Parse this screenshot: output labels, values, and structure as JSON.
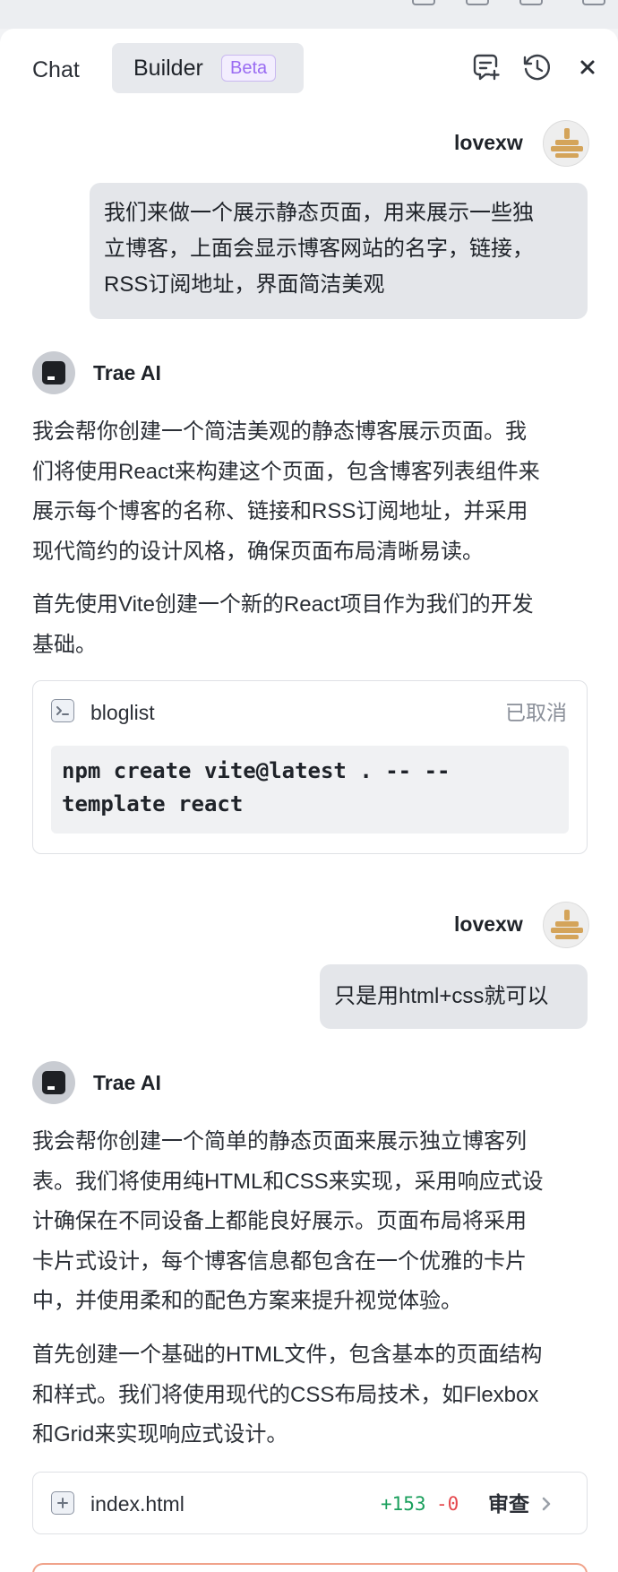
{
  "header": {
    "tab_chat": "Chat",
    "tab_builder": "Builder",
    "beta_badge": "Beta",
    "icons": [
      "new-chat-icon",
      "history-icon",
      "close-icon"
    ]
  },
  "messages": {
    "user1": {
      "name": "lovexw",
      "lines": [
        "我们来做一个展示静态页面，用来展示一些独",
        "立博客，上面会显示博客网站的名字，链接，",
        "RSS订阅地址，界面简洁美观"
      ]
    },
    "ai1": {
      "name": "Trae AI",
      "para1": [
        "我会帮你创建一个简洁美观的静态博客展示页面。我",
        "们将使用React来构建这个页面，包含博客列表组件来",
        "展示每个博客的名称、链接和RSS订阅地址，并采用",
        "现代简约的设计风格，确保页面布局清晰易读。"
      ],
      "para2": [
        "首先使用Vite创建一个新的React项目作为我们的开发",
        "基础。"
      ],
      "terminal": {
        "title": "bloglist",
        "status": "已取消",
        "command_lines": [
          "npm create vite@latest . -- --",
          "template react"
        ]
      }
    },
    "user2": {
      "name": "lovexw",
      "text": "只是用html+css就可以"
    },
    "ai2": {
      "name": "Trae AI",
      "para1": [
        "我会帮你创建一个简单的静态页面来展示独立博客列",
        "表。我们将使用纯HTML和CSS来实现，采用响应式设",
        "计确保在不同设备上都能良好展示。页面布局将采用",
        "卡片式设计，每个博客信息都包含在一个优雅的卡片",
        "中，并使用柔和的配色方案来提升视觉体验。"
      ],
      "para2": [
        "首先创建一个基础的HTML文件，包含基本的页面结构",
        "和样式。我们将使用现代的CSS布局技术，如Flexbox",
        "和Grid来实现响应式设计。"
      ],
      "file": {
        "name": "index.html",
        "added": "+153",
        "removed": "-0",
        "review": "审查"
      }
    }
  },
  "colors": {
    "accent_purple": "#9a6cf2",
    "added_green": "#1a9f5c",
    "removed_red": "#e5484d",
    "avatar_gold": "#d4a45a"
  }
}
